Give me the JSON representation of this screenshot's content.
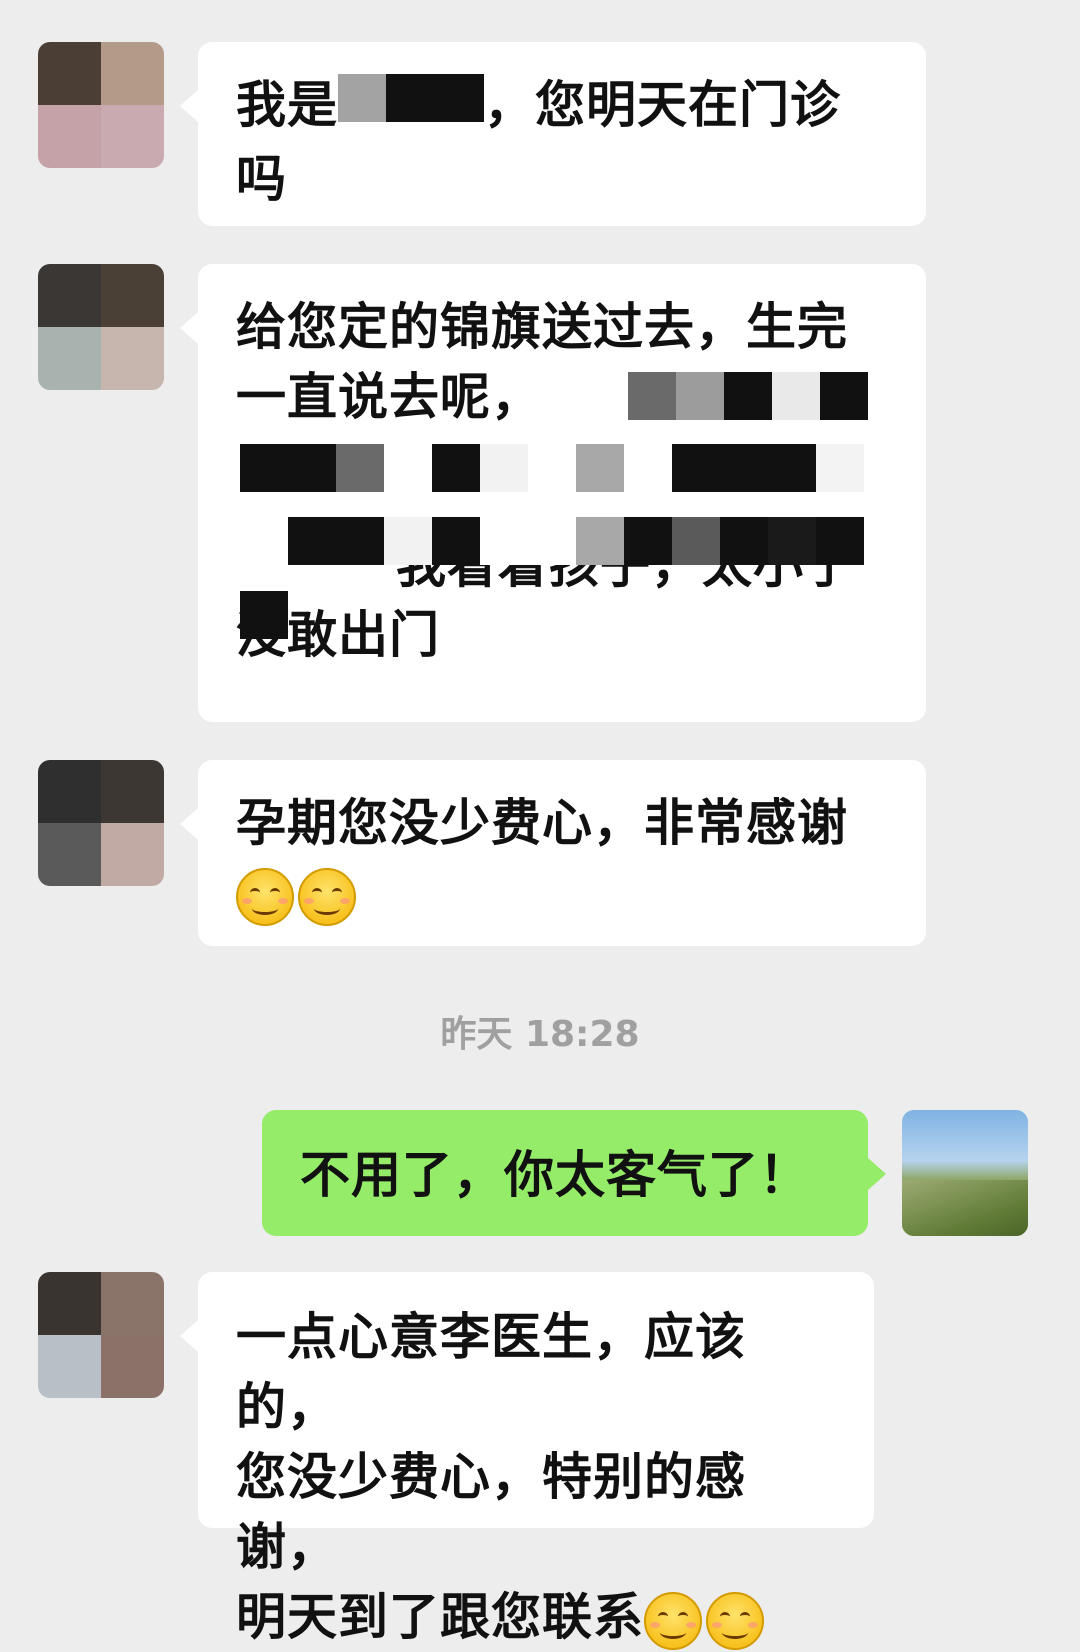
{
  "messages": [
    {
      "id": "m1",
      "side": "in",
      "text_a": "我是",
      "text_b": "，您明天在门诊",
      "text_c": "吗"
    },
    {
      "id": "m2",
      "side": "in",
      "line1": "给您定的锦旗送过去，生完",
      "line2": "一直说去呢，",
      "line4": "我看着孩子，太小了",
      "line5": "没敢出门"
    },
    {
      "id": "m3",
      "side": "in",
      "line1": "孕期您没少费心，非常感谢",
      "emoji": "smile-emoji"
    },
    {
      "id": "m4",
      "side": "out",
      "text": "不用了，你太客气了！"
    },
    {
      "id": "m5",
      "side": "in",
      "line1": "一点心意李医生，应该的，",
      "line2": "您没少费心，特别的感谢，",
      "line3": "明天到了跟您联系",
      "emoji": "smile-emoji"
    }
  ],
  "timestamp": "昨天 18:28",
  "colors": {
    "background": "#ededed",
    "bubble_in": "#ffffff",
    "bubble_out": "#95ec69",
    "timestamp": "#a0a0a0"
  },
  "icons": {
    "avatar_contact": "pixelated-avatar",
    "avatar_self": "landscape-avatar",
    "emoji": "smiling-face-emoji"
  }
}
